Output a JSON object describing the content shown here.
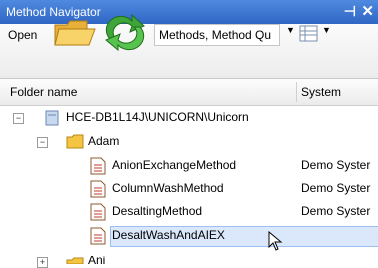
{
  "window": {
    "title": "Method Navigator",
    "pin_glyph": "⊣",
    "close_glyph": "✕"
  },
  "toolbar": {
    "open_label": "Open",
    "combo_value": "Methods, Method Qu",
    "combo_arrow": "▼",
    "view_arrow": "▼"
  },
  "columns": {
    "name": "Folder name",
    "system": "System"
  },
  "tree": {
    "server": {
      "label": "HCE-DB1L14J\\UNICORN\\Unicorn",
      "expander": "−"
    },
    "folder": {
      "label": "Adam",
      "expander": "−"
    },
    "items": [
      {
        "label": "AnionExchangeMethod",
        "system": "Demo Syster"
      },
      {
        "label": "ColumnWashMethod",
        "system": "Demo Syster"
      },
      {
        "label": "DesaltingMethod",
        "system": "Demo Syster"
      },
      {
        "label": "DesaltWashAndAIEX",
        "system": ""
      }
    ],
    "next_folder": {
      "label": "Ani",
      "expander": "+"
    }
  },
  "colors": {
    "titlebar": "#3a74d6",
    "selection": "#dbe8fb",
    "folder": "#f5c542"
  }
}
